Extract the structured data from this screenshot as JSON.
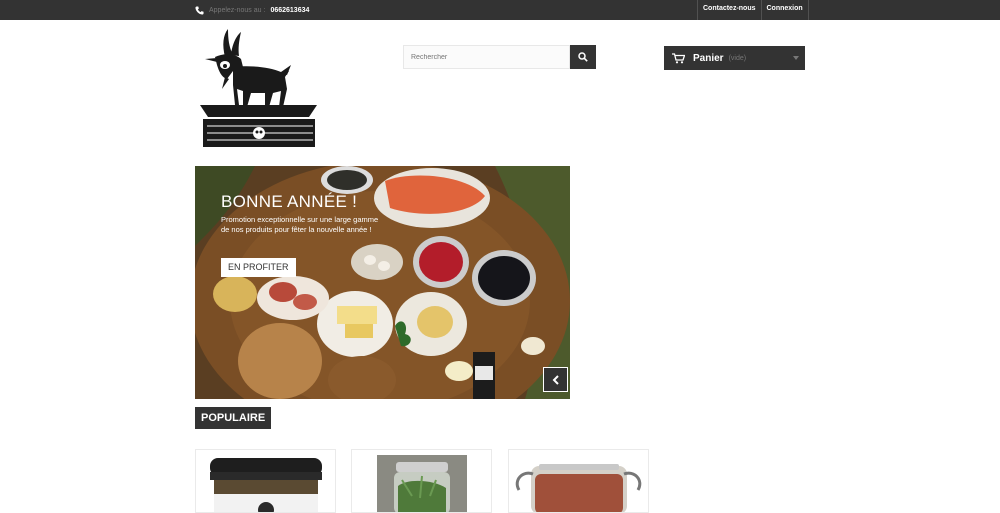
{
  "topbar": {
    "phone_label": "Appelez-nous au :",
    "phone_number": "0662613634",
    "links": [
      "Contactez-nous",
      "Connexion"
    ]
  },
  "header": {
    "search": {
      "placeholder": "Rechercher"
    },
    "cart": {
      "label": "Panier",
      "status": "(vide)"
    }
  },
  "slider": {
    "title": "BONNE ANNÉE !",
    "text": "Promotion exceptionnelle sur une large gamme de nos produits pour fêter la nouvelle année !",
    "button": "EN PROFITER"
  },
  "products_section": {
    "tab_label": "POPULAIRE"
  },
  "colors": {
    "dark": "#333333",
    "white": "#ffffff"
  },
  "icons": [
    "phone-icon",
    "search-icon",
    "cart-icon",
    "chevron-left-icon",
    "goat-logo"
  ]
}
